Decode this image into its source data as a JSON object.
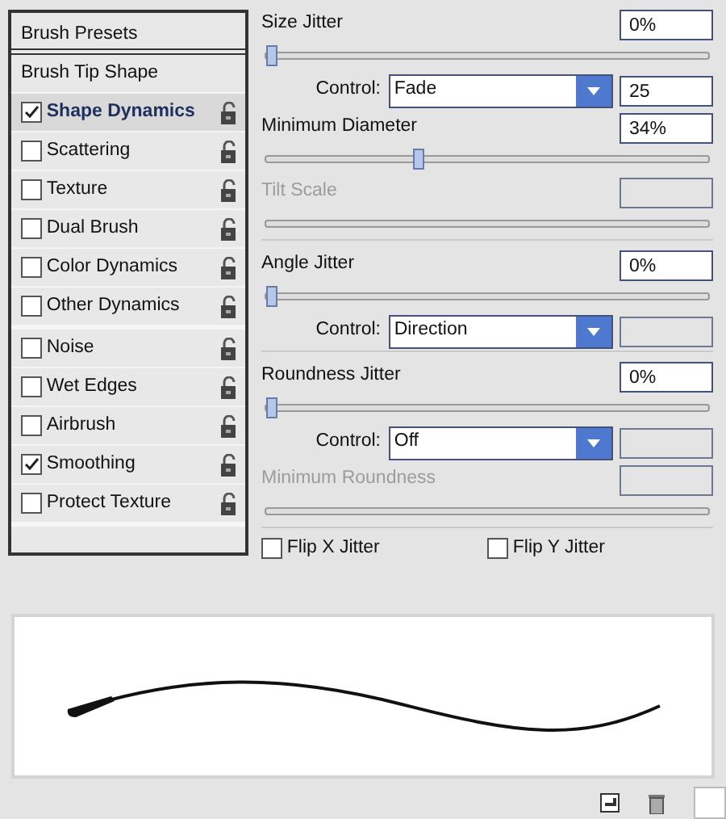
{
  "sidebar": {
    "header": "Brush Presets",
    "sections": [
      {
        "items": [
          {
            "kind": "plain",
            "label": "Brush Tip Shape",
            "selected": false
          },
          {
            "kind": "option",
            "label": "Shape Dynamics",
            "checked": true,
            "selected": true
          },
          {
            "kind": "option",
            "label": "Scattering",
            "checked": false,
            "selected": false
          },
          {
            "kind": "option",
            "label": "Texture",
            "checked": false,
            "selected": false
          },
          {
            "kind": "option",
            "label": "Dual Brush",
            "checked": false,
            "selected": false
          },
          {
            "kind": "option",
            "label": "Color Dynamics",
            "checked": false,
            "selected": false
          },
          {
            "kind": "option",
            "label": "Other Dynamics",
            "checked": false,
            "selected": false
          }
        ]
      },
      {
        "items": [
          {
            "kind": "option",
            "label": "Noise",
            "checked": false,
            "selected": false
          },
          {
            "kind": "option",
            "label": "Wet Edges",
            "checked": false,
            "selected": false
          },
          {
            "kind": "option",
            "label": "Airbrush",
            "checked": false,
            "selected": false
          },
          {
            "kind": "option",
            "label": "Smoothing",
            "checked": true,
            "selected": false
          },
          {
            "kind": "option",
            "label": "Protect Texture",
            "checked": false,
            "selected": false
          }
        ]
      }
    ]
  },
  "settings": {
    "groups": [
      {
        "rows": [
          {
            "kind": "slider",
            "label": "Size Jitter",
            "value": "0%",
            "level": 0,
            "disabled": false
          },
          {
            "kind": "control",
            "label": "Control:",
            "option": "Fade",
            "value": "25"
          },
          {
            "kind": "slider",
            "label": "Minimum Diameter",
            "value": "34%",
            "level": 0.34,
            "disabled": false
          },
          {
            "kind": "slider",
            "label": "Tilt Scale",
            "disabled": true
          }
        ]
      },
      {
        "rows": [
          {
            "kind": "slider",
            "label": "Angle Jitter",
            "value": "0%",
            "level": 0,
            "disabled": false
          },
          {
            "kind": "control",
            "label": "Control:",
            "option": "Direction"
          }
        ]
      },
      {
        "rows": [
          {
            "kind": "slider",
            "label": "Roundness Jitter",
            "value": "0%",
            "level": 0,
            "disabled": false
          },
          {
            "kind": "control",
            "label": "Control:",
            "option": "Off"
          },
          {
            "kind": "slider",
            "label": "Minimum Roundness",
            "disabled": true
          }
        ]
      }
    ],
    "flips": [
      {
        "label": "Flip X Jitter",
        "checked": false
      },
      {
        "label": "Flip Y Jitter",
        "checked": false
      }
    ]
  }
}
